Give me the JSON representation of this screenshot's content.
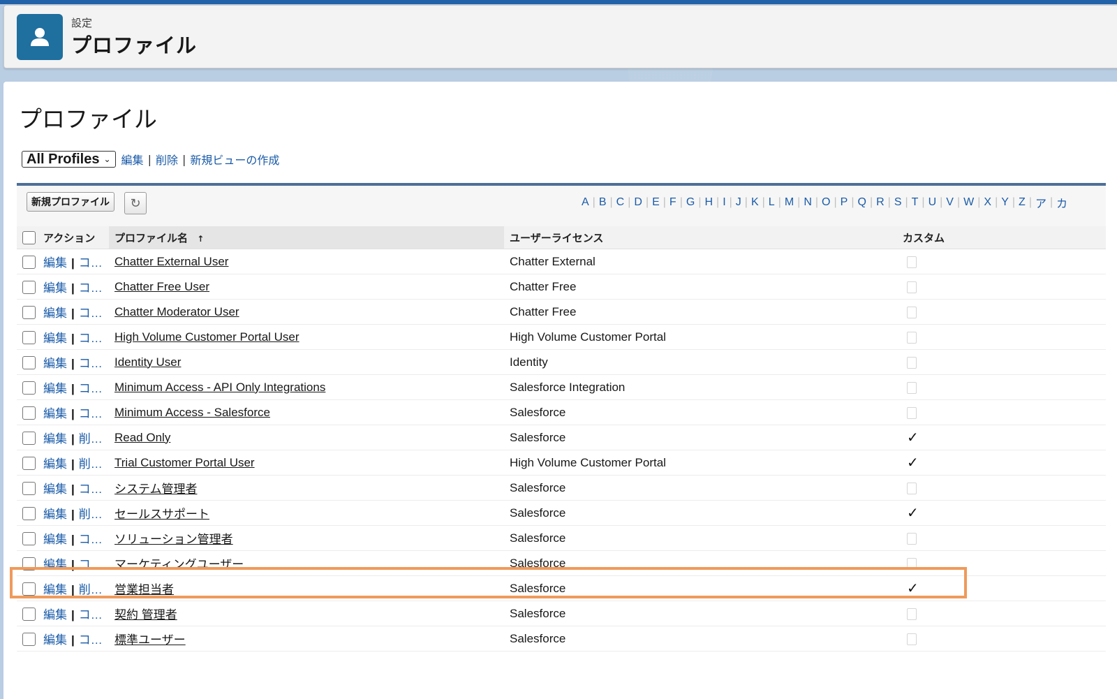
{
  "header": {
    "eyebrow": "設定",
    "title": "プロファイル",
    "icon": "user-icon"
  },
  "page": {
    "title": "プロファイル"
  },
  "view": {
    "selected": "All Profiles",
    "links": [
      "編集",
      "削除",
      "新規ビューの作成"
    ]
  },
  "toolbar": {
    "new_button": "新規プロファイル",
    "refresh_icon": "refresh-icon",
    "alphabet": [
      "A",
      "B",
      "C",
      "D",
      "E",
      "F",
      "G",
      "H",
      "I",
      "J",
      "K",
      "L",
      "M",
      "N",
      "O",
      "P",
      "Q",
      "R",
      "S",
      "T",
      "U",
      "V",
      "W",
      "X",
      "Y",
      "Z",
      "ア",
      "カ"
    ]
  },
  "table": {
    "columns": {
      "action": "アクション",
      "name": "プロファイル名",
      "sort_arrow": "↑",
      "license": "ユーザーライセンス",
      "custom": "カスタム"
    },
    "rows": [
      {
        "edit": "編集",
        "second": "コ…",
        "name": "Chatter External User",
        "license": "Chatter External",
        "custom": false
      },
      {
        "edit": "編集",
        "second": "コ…",
        "name": "Chatter Free User",
        "license": "Chatter Free",
        "custom": false
      },
      {
        "edit": "編集",
        "second": "コ…",
        "name": "Chatter Moderator User",
        "license": "Chatter Free",
        "custom": false
      },
      {
        "edit": "編集",
        "second": "コ…",
        "name": "High Volume Customer Portal User",
        "license": "High Volume Customer Portal",
        "custom": false
      },
      {
        "edit": "編集",
        "second": "コ…",
        "name": "Identity User",
        "license": "Identity",
        "custom": false
      },
      {
        "edit": "編集",
        "second": "コ…",
        "name": "Minimum Access - API Only Integrations",
        "license": "Salesforce Integration",
        "custom": false
      },
      {
        "edit": "編集",
        "second": "コ…",
        "name": "Minimum Access - Salesforce",
        "license": "Salesforce",
        "custom": false
      },
      {
        "edit": "編集",
        "second": "削…",
        "name": "Read Only",
        "license": "Salesforce",
        "custom": true
      },
      {
        "edit": "編集",
        "second": "削…",
        "name": "Trial Customer Portal User",
        "license": "High Volume Customer Portal",
        "custom": true
      },
      {
        "edit": "編集",
        "second": "コ…",
        "name": "システム管理者",
        "license": "Salesforce",
        "custom": false
      },
      {
        "edit": "編集",
        "second": "削…",
        "name": "セールスサポート",
        "license": "Salesforce",
        "custom": true
      },
      {
        "edit": "編集",
        "second": "コ…",
        "name": "ソリューション管理者",
        "license": "Salesforce",
        "custom": false
      },
      {
        "edit": "編集",
        "second": "コ…",
        "name": "マーケティングユーザー",
        "license": "Salesforce",
        "custom": false
      },
      {
        "edit": "編集",
        "second": "削…",
        "name": "営業担当者",
        "license": "Salesforce",
        "custom": true
      },
      {
        "edit": "編集",
        "second": "コ…",
        "name": "契約 管理者",
        "license": "Salesforce",
        "custom": false
      },
      {
        "edit": "編集",
        "second": "コ…",
        "name": "標準ユーザー",
        "license": "Salesforce",
        "custom": false
      }
    ]
  },
  "colors": {
    "header_icon": "#1f6f9f",
    "link": "#1a5ba8",
    "highlight": "#ef9a5b",
    "panel_border": "#4d6f99"
  }
}
